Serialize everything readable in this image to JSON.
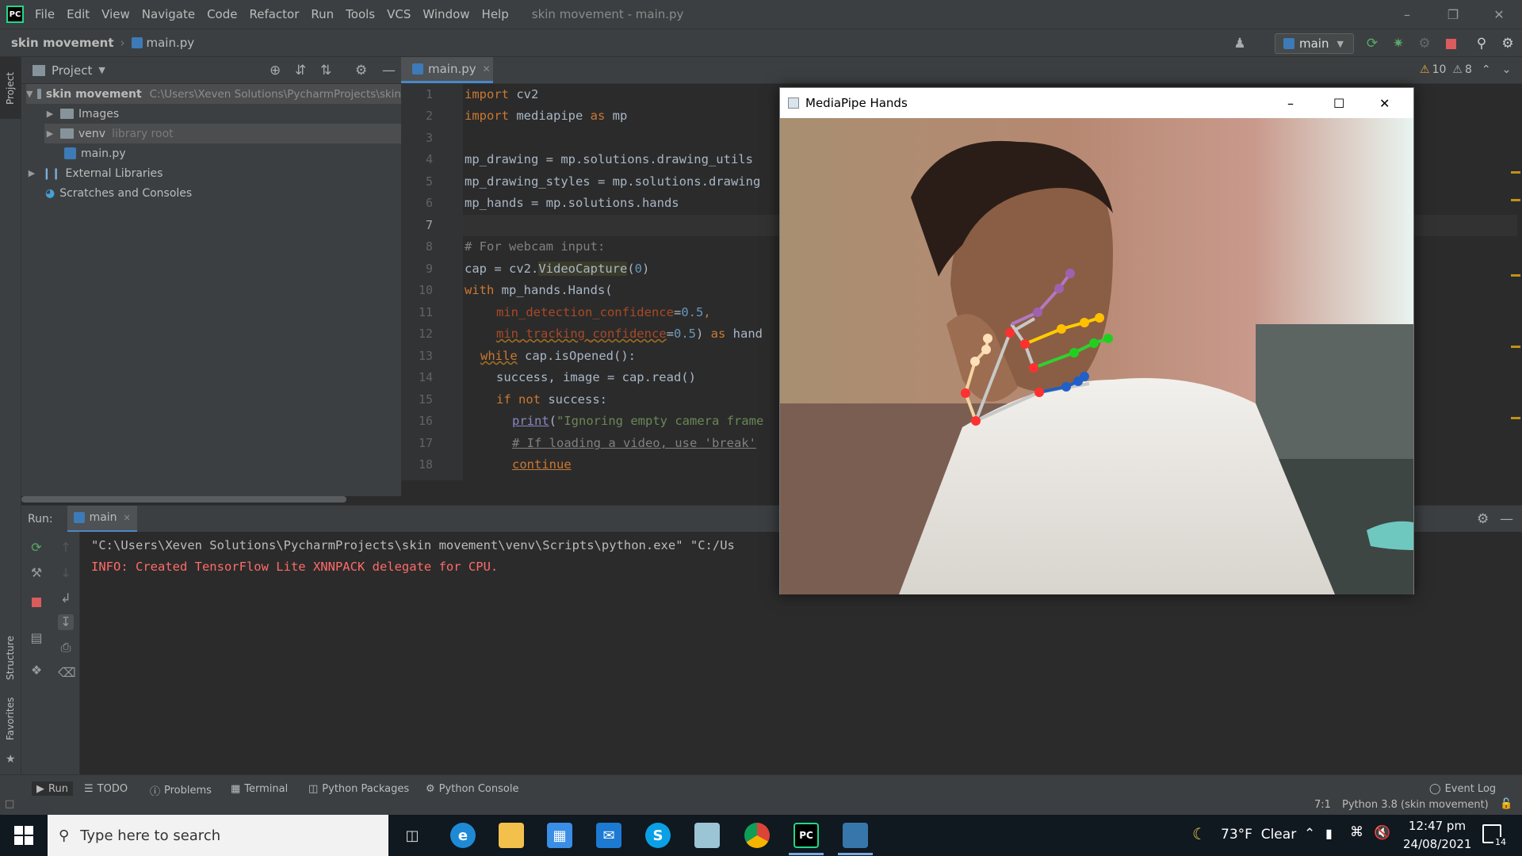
{
  "app": {
    "window_title": "skin movement - main.py",
    "menu": [
      "File",
      "Edit",
      "View",
      "Navigate",
      "Code",
      "Refactor",
      "Run",
      "Tools",
      "VCS",
      "Window",
      "Help"
    ]
  },
  "navbar": {
    "project": "skin movement",
    "file": "main.py",
    "run_config": "main"
  },
  "project_panel": {
    "title": "Project",
    "root_name": "skin movement",
    "root_path": "C:\\Users\\Xeven Solutions\\PycharmProjects\\skin",
    "items": [
      {
        "label": "Images",
        "extra": ""
      },
      {
        "label": "venv",
        "extra": "library root"
      },
      {
        "label": "main.py",
        "extra": ""
      }
    ],
    "external": "External Libraries",
    "scratches": "Scratches and Consoles"
  },
  "editor": {
    "tab": "main.py",
    "warnings": "10",
    "weak_warnings": "8",
    "lines": [
      "1",
      "2",
      "3",
      "4",
      "5",
      "6",
      "7",
      "8",
      "9",
      "10",
      "11",
      "12",
      "13",
      "14",
      "15",
      "16",
      "17",
      "18"
    ]
  },
  "code_text": {
    "l1_kw": "import",
    "l1_rest": " cv2",
    "l2_kw": "import",
    "l2_mid": " mediapipe ",
    "l2_as": "as",
    "l2_rest": " mp",
    "l4": "mp_drawing = mp.solutions.drawing_utils",
    "l5": "mp_drawing_styles = mp.solutions.drawing",
    "l6": "mp_hands = mp.solutions.hands",
    "l8": "# For webcam input:",
    "l9_a": "cap = cv2.",
    "l9_b": "VideoCapture",
    "l9_c": "(",
    "l9_d": "0",
    "l9_e": ")",
    "l10_kw": "with",
    "l10_rest": " mp_hands.Hands(",
    "l11_p": "min_detection_confidence",
    "l11_eq": "=",
    "l11_n": "0.5",
    "l11_c": ",",
    "l12_p": "min_tracking_confidence",
    "l12_eq": "=",
    "l12_n": "0.5",
    "l12_c": ") ",
    "l12_as": "as",
    "l12_r": " hand",
    "l13_kw": "while",
    "l13_rest": " cap.isOpened():",
    "l14": "success, image = cap.read()",
    "l15_kw": "if not",
    "l15_rest": " success:",
    "l16_fn": "print",
    "l16_a": "(",
    "l16_s": "\"Ignoring empty camera frame",
    "l17": "# If loading a video, use 'break'",
    "l18": "continue"
  },
  "run_panel": {
    "label": "Run:",
    "tab": "main",
    "line1": "\"C:\\Users\\Xeven Solutions\\PycharmProjects\\skin movement\\venv\\Scripts\\python.exe\" \"C:/Us",
    "line2": "INFO: Created TensorFlow Lite XNNPACK delegate for CPU."
  },
  "side_labels": {
    "project": "Project",
    "structure": "Structure",
    "favorites": "Favorites"
  },
  "bottom_tabs": [
    "Run",
    "TODO",
    "Problems",
    "Terminal",
    "Python Packages",
    "Python Console"
  ],
  "event_log": "Event Log",
  "status": {
    "position": "7:1",
    "interpreter": "Python 3.8 (skin movement)"
  },
  "mediapipe_window": {
    "title": "MediaPipe Hands"
  },
  "taskbar": {
    "search_placeholder": "Type here to search",
    "weather": "73°F  Clear",
    "time": "12:47 pm",
    "date": "24/08/2021",
    "notif_count": "14",
    "pycharm_label": "PC",
    "skype_label": "S"
  },
  "colors": {
    "ide_bg": "#2b2b2b",
    "panel_bg": "#3c3f41",
    "error_red": "#ff6b68",
    "accent_green": "#21d789"
  }
}
